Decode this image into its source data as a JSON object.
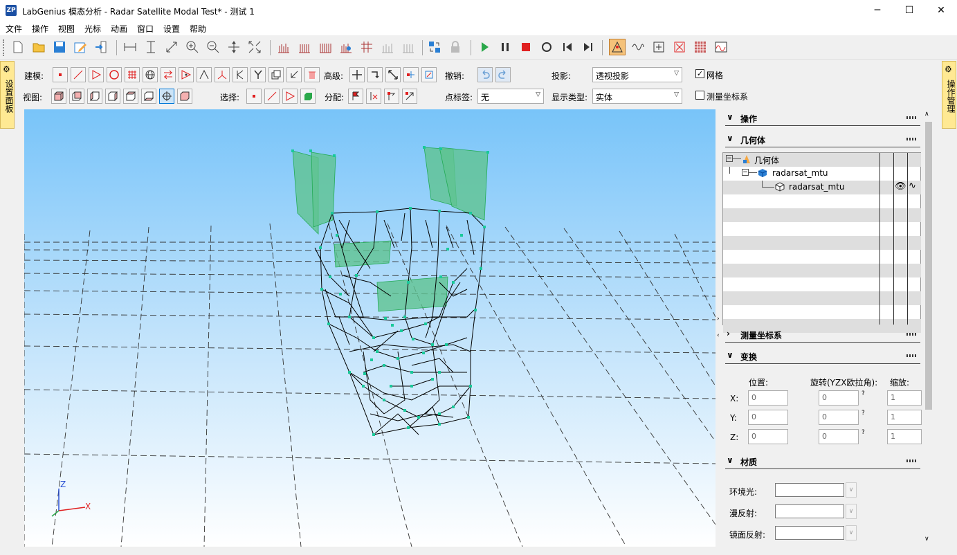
{
  "window": {
    "title": "LabGenius 模态分析 - Radar Satellite Modal Test* - 测试 1",
    "app_icon_text": "ZP",
    "minimize": "─",
    "maximize": "☐",
    "close": "✕"
  },
  "menu": {
    "items": [
      "文件",
      "操作",
      "视图",
      "光标",
      "动画",
      "窗口",
      "设置",
      "帮助"
    ]
  },
  "toolbar": {
    "icons": [
      "new-file-icon",
      "open-folder-icon",
      "save-icon",
      "edit-icon",
      "import-icon",
      "measure-horizontal-icon",
      "measure-vertical-icon",
      "measure-diagonal-icon",
      "zoom-in-icon",
      "zoom-out-icon",
      "pan-icon",
      "fit-icon",
      "bar-chart-icon",
      "bar-chart-icon",
      "bar-chart-icon",
      "bar-chart-icon",
      "grid-chart-icon",
      "grid-chart-icon",
      "grid-chart-icon",
      "swap-icon",
      "lock-icon",
      "play-icon",
      "pause-icon",
      "stop-icon",
      "loop-icon",
      "skip-back-icon",
      "skip-forward-icon",
      "geometry-mode-icon",
      "waveform-icon",
      "frame-icon",
      "shape-icon",
      "matrix-icon",
      "spectrum-icon"
    ]
  },
  "left_sidebar": {
    "label": "设置面板"
  },
  "right_sidebar": {
    "label": "操作管理"
  },
  "controls": {
    "modeling_label": "建模:",
    "view_label": "视图:",
    "select_label": "选择:",
    "advanced_label": "高级:",
    "assign_label": "分配:",
    "undo_label": "撤销:",
    "point_label_label": "点标签:",
    "point_label_value": "无",
    "projection_label": "投影:",
    "projection_value": "透视投影",
    "display_type_label": "显示类型:",
    "display_type_value": "实体",
    "grid_label": "网格",
    "grid_checked": true,
    "measure_coord_label": "测量坐标系",
    "measure_coord_checked": false
  },
  "viewport": {
    "axis_z": "Z",
    "axis_x": "X",
    "background_top": "#78c4f9",
    "node_color": "#19c99a",
    "panel_color": "#5fc391"
  },
  "right_panel": {
    "sections": {
      "operation": "操作",
      "geometry": "几何体",
      "measure_coord": "测量坐标系",
      "transform": "变换",
      "material": "材质"
    },
    "tree": {
      "root": "几何体",
      "child": "radarsat_mtu",
      "leaf": "radarsat_mtu"
    },
    "transform": {
      "position_label": "位置:",
      "rotation_label": "旋转(YZX欧拉角):",
      "scale_label": "缩放:",
      "x_label": "X:",
      "y_label": "Y:",
      "z_label": "Z:",
      "pos_x": "0",
      "pos_y": "0",
      "pos_z": "0",
      "rot_x": "0",
      "rot_y": "0",
      "rot_z": "0",
      "scale_x": "1",
      "scale_y": "1",
      "scale_z": "1",
      "help": "?"
    },
    "material": {
      "ambient_label": "环境光:",
      "diffuse_label": "漫反射:",
      "specular_label": "镜面反射:"
    }
  }
}
